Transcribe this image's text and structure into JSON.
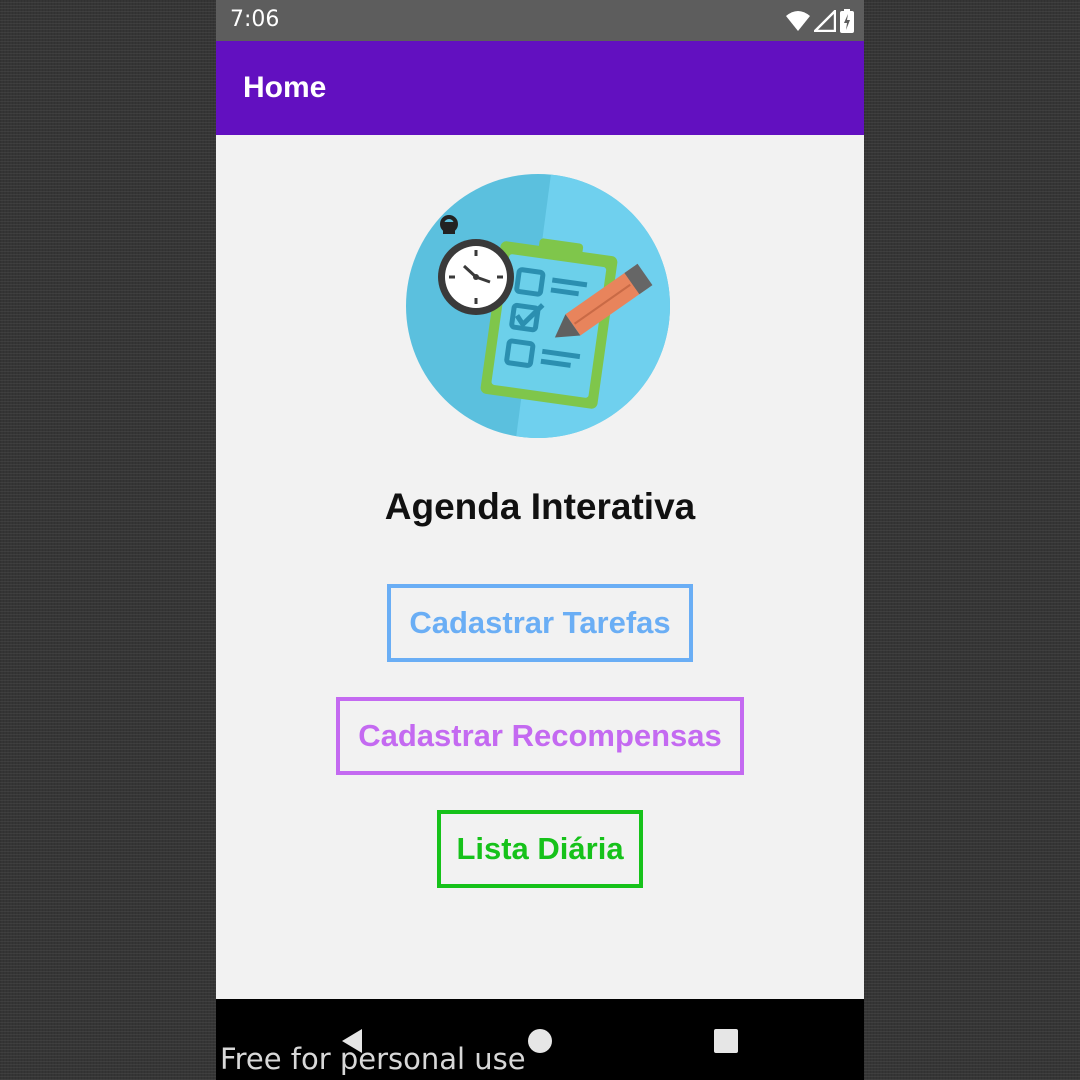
{
  "status_bar": {
    "time": "7:06",
    "icons": [
      "wifi-icon",
      "signal-icon",
      "battery-icon"
    ]
  },
  "app_bar": {
    "title": "Home",
    "color": "#6210c0"
  },
  "main": {
    "logo_icon": "clipboard-checklist-stopwatch-pencil-icon",
    "title": "Agenda Interativa",
    "buttons": [
      {
        "label": "Cadastrar Tarefas",
        "color": "#6aaef5"
      },
      {
        "label": "Cadastrar Recompensas",
        "color": "#c46af1"
      },
      {
        "label": "Lista Diária",
        "color": "#16c21a"
      }
    ]
  },
  "nav_bar": {
    "icons": [
      "back-icon",
      "home-icon",
      "recents-icon"
    ]
  },
  "watermark": "Free for personal use"
}
